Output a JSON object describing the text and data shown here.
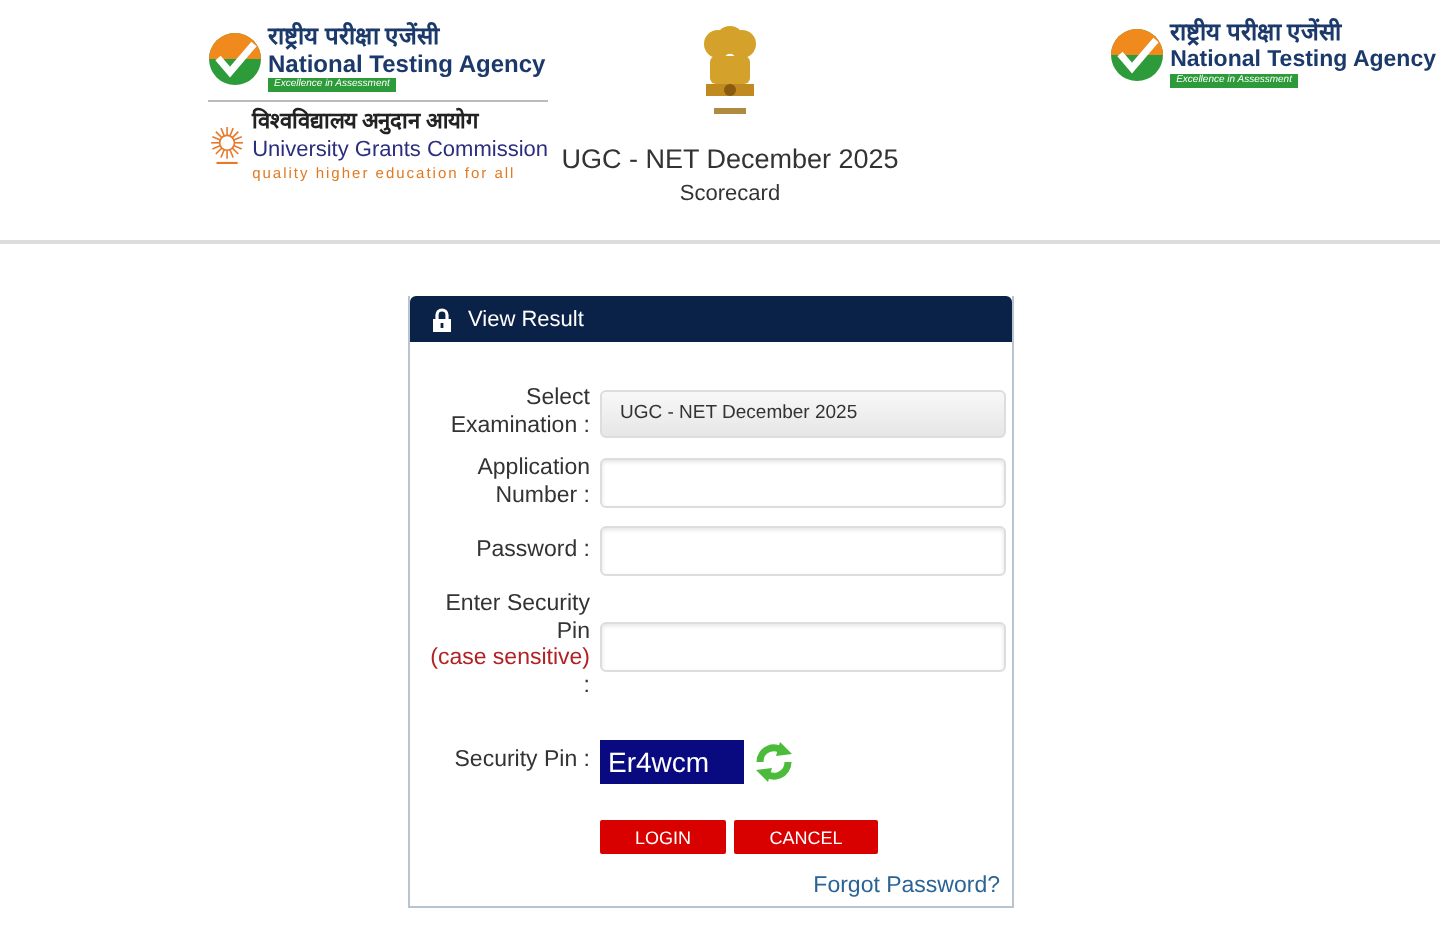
{
  "header": {
    "left_logos": [
      {
        "kind": "nta",
        "hindi": "राष्ट्रीय परीक्षा एजेंसी",
        "name": "National Testing Agency",
        "tagline": "Excellence in Assessment"
      },
      {
        "kind": "ugc",
        "hindi": "विश्वविद्यालय अनुदान आयोग",
        "name": "University Grants Commission",
        "tagline": "quality higher education for all"
      }
    ],
    "title": "UGC - NET December 2025",
    "subtitle": "Scorecard",
    "right_logo": {
      "kind": "nta",
      "hindi": "राष्ट्रीय परीक्षा एजेंसी",
      "name": "National Testing Agency",
      "tagline": "Excellence in Assessment"
    }
  },
  "panel": {
    "title": "View Result",
    "fields": [
      {
        "kind": "select",
        "label": "Select Examination :",
        "value": "UGC - NET December 2025"
      },
      {
        "kind": "input",
        "label": "Application Number :"
      },
      {
        "kind": "input",
        "label": "Password :"
      },
      {
        "kind": "input",
        "label": "Enter Security Pin",
        "note": "(case sensitive)",
        "suffix": ":"
      }
    ],
    "security_pin": {
      "label": "Security Pin :",
      "code": "Er4wcm"
    },
    "buttons": [
      "LOGIN",
      "CANCEL"
    ],
    "link": "Forgot Password?"
  }
}
